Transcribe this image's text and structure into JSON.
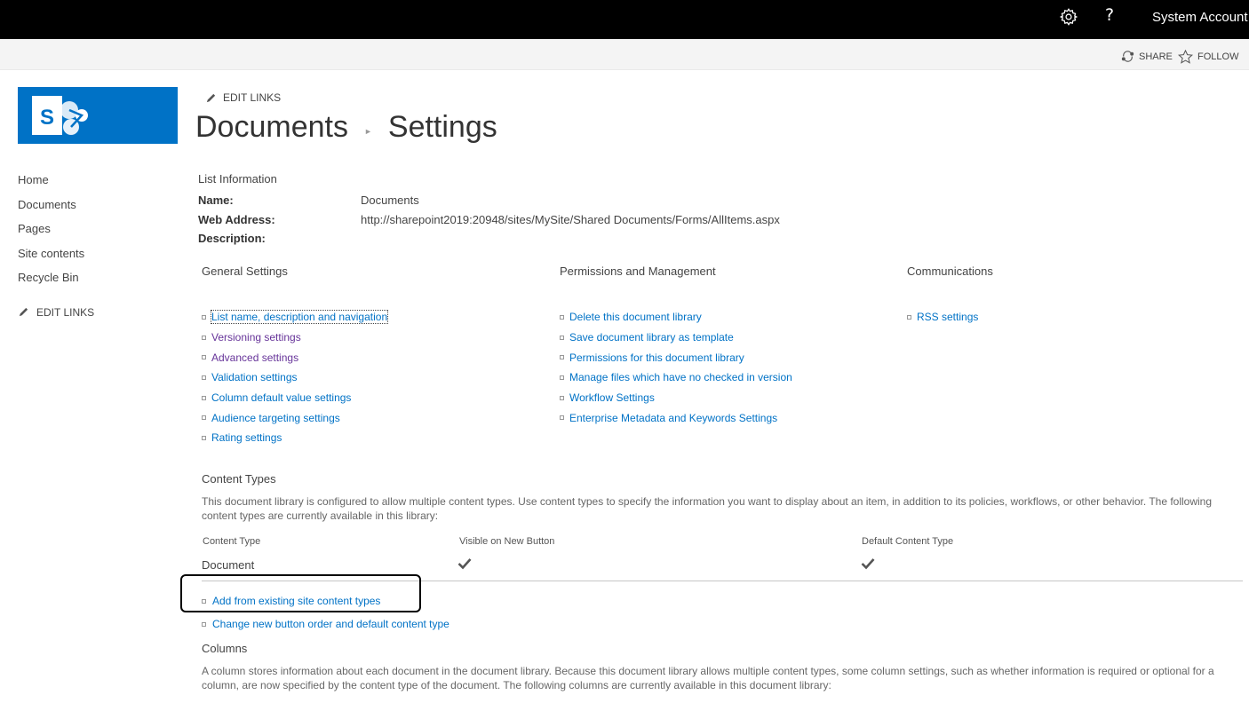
{
  "suitebar": {
    "account": "System Account",
    "help": "?",
    "gear_icon": "gear-icon"
  },
  "ribbon": {
    "share": "SHARE",
    "follow": "FOLLOW"
  },
  "header": {
    "edit_links": "EDIT LINKS",
    "title_part1": "Documents",
    "title_part2": "Settings"
  },
  "leftnav": {
    "items": [
      "Home",
      "Documents",
      "Pages",
      "Site contents",
      "Recycle Bin"
    ],
    "edit_links": "EDIT LINKS"
  },
  "list_info": {
    "heading": "List Information",
    "name_label": "Name:",
    "name_value": "Documents",
    "web_address_label": "Web Address:",
    "web_address_value": "http://sharepoint2019:20948/sites/MySite/Shared Documents/Forms/AllItems.aspx",
    "description_label": "Description:"
  },
  "general_settings": {
    "heading": "General Settings",
    "links": [
      "List name, description and navigation",
      "Versioning settings",
      "Advanced settings",
      "Validation settings",
      "Column default value settings",
      "Audience targeting settings",
      "Rating settings"
    ]
  },
  "permissions": {
    "heading": "Permissions and Management",
    "links": [
      "Delete this document library",
      "Save document library as template",
      "Permissions for this document library",
      "Manage files which have no checked in version",
      "Workflow Settings",
      "Enterprise Metadata and Keywords Settings"
    ]
  },
  "communications": {
    "heading": "Communications",
    "links": [
      "RSS settings"
    ]
  },
  "content_types": {
    "heading": "Content Types",
    "description": "This document library is configured to allow multiple content types. Use content types to specify the information you want to display about an item, in addition to its policies, workflows, or other behavior. The following content types are currently available in this library:",
    "col_content_type": "Content Type",
    "col_visible": "Visible on New Button",
    "col_default": "Default Content Type",
    "row_name": "Document",
    "links": [
      "Add from existing site content types",
      "Change new button order and default content type"
    ]
  },
  "columns": {
    "heading": "Columns",
    "description": "A column stores information about each document in the document library. Because this document library allows multiple content types, some column settings, such as whether information is required or optional for a column, are now specified by the content type of the document. The following columns are currently available in this document library:"
  }
}
